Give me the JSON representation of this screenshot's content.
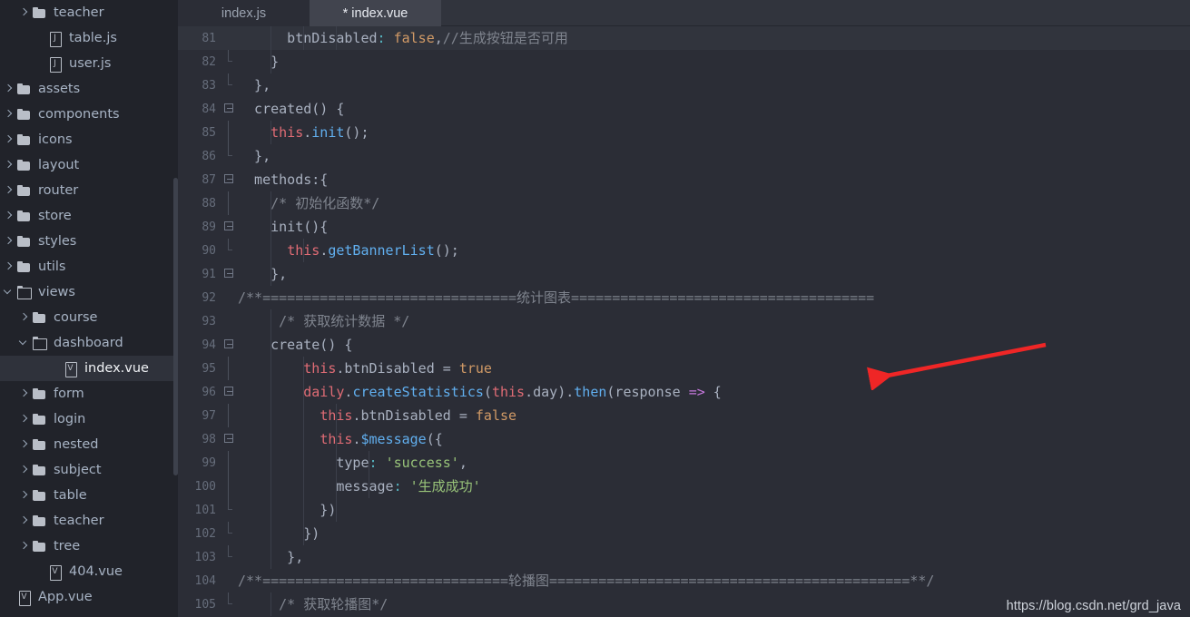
{
  "sidebar": {
    "scrollbar": true,
    "items": [
      {
        "label": "teacher",
        "indent": 2,
        "arrow": "right",
        "icon": "folder-icon",
        "selected": false
      },
      {
        "label": "table.js",
        "indent": 3,
        "arrow": "none",
        "icon": "js-file-icon",
        "selected": false
      },
      {
        "label": "user.js",
        "indent": 3,
        "arrow": "none",
        "icon": "js-file-icon",
        "selected": false
      },
      {
        "label": "assets",
        "indent": 1,
        "arrow": "right",
        "icon": "folder-icon",
        "selected": false
      },
      {
        "label": "components",
        "indent": 1,
        "arrow": "right",
        "icon": "folder-icon",
        "selected": false
      },
      {
        "label": "icons",
        "indent": 1,
        "arrow": "right",
        "icon": "folder-icon",
        "selected": false
      },
      {
        "label": "layout",
        "indent": 1,
        "arrow": "right",
        "icon": "folder-icon",
        "selected": false
      },
      {
        "label": "router",
        "indent": 1,
        "arrow": "right",
        "icon": "folder-icon",
        "selected": false
      },
      {
        "label": "store",
        "indent": 1,
        "arrow": "right",
        "icon": "folder-icon",
        "selected": false
      },
      {
        "label": "styles",
        "indent": 1,
        "arrow": "right",
        "icon": "folder-icon",
        "selected": false
      },
      {
        "label": "utils",
        "indent": 1,
        "arrow": "right",
        "icon": "folder-icon",
        "selected": false
      },
      {
        "label": "views",
        "indent": 1,
        "arrow": "down",
        "icon": "folder-open-icon",
        "selected": false
      },
      {
        "label": "course",
        "indent": 2,
        "arrow": "right",
        "icon": "folder-icon",
        "selected": false
      },
      {
        "label": "dashboard",
        "indent": 2,
        "arrow": "down",
        "icon": "folder-open-icon",
        "selected": false
      },
      {
        "label": "index.vue",
        "indent": 4,
        "arrow": "none",
        "icon": "vue-file-icon",
        "selected": true
      },
      {
        "label": "form",
        "indent": 2,
        "arrow": "right",
        "icon": "folder-icon",
        "selected": false
      },
      {
        "label": "login",
        "indent": 2,
        "arrow": "right",
        "icon": "folder-icon",
        "selected": false
      },
      {
        "label": "nested",
        "indent": 2,
        "arrow": "right",
        "icon": "folder-icon",
        "selected": false
      },
      {
        "label": "subject",
        "indent": 2,
        "arrow": "right",
        "icon": "folder-icon",
        "selected": false
      },
      {
        "label": "table",
        "indent": 2,
        "arrow": "right",
        "icon": "folder-icon",
        "selected": false
      },
      {
        "label": "teacher",
        "indent": 2,
        "arrow": "right",
        "icon": "folder-icon",
        "selected": false
      },
      {
        "label": "tree",
        "indent": 2,
        "arrow": "right",
        "icon": "folder-icon",
        "selected": false
      },
      {
        "label": "404.vue",
        "indent": 3,
        "arrow": "none",
        "icon": "vue-file-icon",
        "selected": false
      },
      {
        "label": "App.vue",
        "indent": 1,
        "arrow": "none",
        "icon": "vue-file-icon",
        "selected": false
      }
    ]
  },
  "tabs": [
    {
      "label": "index.js",
      "active": false,
      "modified": false
    },
    {
      "label": "* index.vue",
      "active": true,
      "modified": true
    }
  ],
  "editor": {
    "watermark": "https://blog.csdn.net/grd_java",
    "lines": [
      {
        "number": "81",
        "current": true,
        "fold": "none",
        "guides": [
          4,
          8,
          12
        ],
        "tokens": [
          {
            "text": "      btnDisabled",
            "cls": "t-plain"
          },
          {
            "text": ":",
            "cls": "t-op"
          },
          {
            "text": " ",
            "cls": "t-plain"
          },
          {
            "text": "false",
            "cls": "t-num"
          },
          {
            "text": ",",
            "cls": "t-plain"
          },
          {
            "text": "//生成按钮是否可用",
            "cls": "t-cmt"
          }
        ]
      },
      {
        "number": "82",
        "current": false,
        "fold": "end",
        "guides": [
          4
        ],
        "tokens": [
          {
            "text": "    }",
            "cls": "t-plain"
          }
        ]
      },
      {
        "number": "83",
        "current": false,
        "fold": "end",
        "guides": [],
        "tokens": [
          {
            "text": "  },",
            "cls": "t-plain"
          }
        ]
      },
      {
        "number": "84",
        "current": false,
        "fold": "box",
        "guides": [],
        "tokens": [
          {
            "text": "  created",
            "cls": "t-plain"
          },
          {
            "text": "() {",
            "cls": "t-plain"
          }
        ]
      },
      {
        "number": "85",
        "current": false,
        "fold": "line",
        "guides": [
          4
        ],
        "tokens": [
          {
            "text": "    ",
            "cls": "t-plain"
          },
          {
            "text": "this",
            "cls": "t-this"
          },
          {
            "text": ".",
            "cls": "t-plain"
          },
          {
            "text": "init",
            "cls": "t-fn"
          },
          {
            "text": "();",
            "cls": "t-plain"
          }
        ]
      },
      {
        "number": "86",
        "current": false,
        "fold": "end",
        "guides": [],
        "tokens": [
          {
            "text": "  },",
            "cls": "t-plain"
          }
        ]
      },
      {
        "number": "87",
        "current": false,
        "fold": "box",
        "guides": [],
        "tokens": [
          {
            "text": "  methods:{",
            "cls": "t-plain"
          }
        ]
      },
      {
        "number": "88",
        "current": false,
        "fold": "line",
        "guides": [
          4
        ],
        "tokens": [
          {
            "text": "    /* 初始化函数*/",
            "cls": "t-cmt"
          }
        ]
      },
      {
        "number": "89",
        "current": false,
        "fold": "box",
        "guides": [
          4
        ],
        "tokens": [
          {
            "text": "    init(){",
            "cls": "t-plain"
          }
        ]
      },
      {
        "number": "90",
        "current": false,
        "fold": "end",
        "guides": [
          4,
          8
        ],
        "tokens": [
          {
            "text": "      ",
            "cls": "t-plain"
          },
          {
            "text": "this",
            "cls": "t-this"
          },
          {
            "text": ".",
            "cls": "t-plain"
          },
          {
            "text": "getBannerList",
            "cls": "t-fn"
          },
          {
            "text": "();",
            "cls": "t-plain"
          }
        ]
      },
      {
        "number": "91",
        "current": false,
        "fold": "box",
        "guides": [
          4
        ],
        "tokens": [
          {
            "text": "    },",
            "cls": "t-plain"
          }
        ]
      },
      {
        "number": "92",
        "current": false,
        "fold": "none",
        "guides": [],
        "tokens": [
          {
            "text": "/**===============================统计图表=====================================",
            "cls": "t-cmt"
          }
        ]
      },
      {
        "number": "93",
        "current": false,
        "fold": "none",
        "guides": [
          4
        ],
        "tokens": [
          {
            "text": "     /* 获取统计数据 */",
            "cls": "t-cmt"
          }
        ]
      },
      {
        "number": "94",
        "current": false,
        "fold": "box",
        "guides": [
          4
        ],
        "tokens": [
          {
            "text": "    create() {",
            "cls": "t-plain"
          }
        ]
      },
      {
        "number": "95",
        "current": false,
        "fold": "line",
        "guides": [
          4,
          8
        ],
        "tokens": [
          {
            "text": "        ",
            "cls": "t-plain"
          },
          {
            "text": "this",
            "cls": "t-this"
          },
          {
            "text": ".btnDisabled ",
            "cls": "t-plain"
          },
          {
            "text": "=",
            "cls": "t-plain"
          },
          {
            "text": " ",
            "cls": "t-plain"
          },
          {
            "text": "true",
            "cls": "t-num"
          }
        ]
      },
      {
        "number": "96",
        "current": false,
        "fold": "box",
        "guides": [
          4,
          8
        ],
        "tokens": [
          {
            "text": "        ",
            "cls": "t-plain"
          },
          {
            "text": "daily",
            "cls": "t-this"
          },
          {
            "text": ".",
            "cls": "t-plain"
          },
          {
            "text": "createStatistics",
            "cls": "t-fn"
          },
          {
            "text": "(",
            "cls": "t-plain"
          },
          {
            "text": "this",
            "cls": "t-this"
          },
          {
            "text": ".day).",
            "cls": "t-plain"
          },
          {
            "text": "then",
            "cls": "t-fn"
          },
          {
            "text": "(response ",
            "cls": "t-plain"
          },
          {
            "text": "=>",
            "cls": "t-arrow"
          },
          {
            "text": " {",
            "cls": "t-plain"
          }
        ]
      },
      {
        "number": "97",
        "current": false,
        "fold": "line",
        "guides": [
          4,
          8,
          12
        ],
        "tokens": [
          {
            "text": "          ",
            "cls": "t-plain"
          },
          {
            "text": "this",
            "cls": "t-this"
          },
          {
            "text": ".btnDisabled ",
            "cls": "t-plain"
          },
          {
            "text": "=",
            "cls": "t-plain"
          },
          {
            "text": " ",
            "cls": "t-plain"
          },
          {
            "text": "false",
            "cls": "t-num"
          }
        ]
      },
      {
        "number": "98",
        "current": false,
        "fold": "box",
        "guides": [
          4,
          8,
          12
        ],
        "tokens": [
          {
            "text": "          ",
            "cls": "t-plain"
          },
          {
            "text": "this",
            "cls": "t-this"
          },
          {
            "text": ".",
            "cls": "t-plain"
          },
          {
            "text": "$message",
            "cls": "t-fn"
          },
          {
            "text": "({",
            "cls": "t-plain"
          }
        ]
      },
      {
        "number": "99",
        "current": false,
        "fold": "line",
        "guides": [
          4,
          8,
          12,
          16
        ],
        "tokens": [
          {
            "text": "            type",
            "cls": "t-plain"
          },
          {
            "text": ":",
            "cls": "t-op"
          },
          {
            "text": " ",
            "cls": "t-plain"
          },
          {
            "text": "'success'",
            "cls": "t-str"
          },
          {
            "text": ",",
            "cls": "t-plain"
          }
        ]
      },
      {
        "number": "100",
        "current": false,
        "fold": "line",
        "guides": [
          4,
          8,
          12,
          16
        ],
        "tokens": [
          {
            "text": "            message",
            "cls": "t-plain"
          },
          {
            "text": ":",
            "cls": "t-op"
          },
          {
            "text": " ",
            "cls": "t-plain"
          },
          {
            "text": "'生成成功'",
            "cls": "t-str"
          }
        ]
      },
      {
        "number": "101",
        "current": false,
        "fold": "end",
        "guides": [
          4,
          8,
          12
        ],
        "tokens": [
          {
            "text": "          })",
            "cls": "t-plain"
          }
        ]
      },
      {
        "number": "102",
        "current": false,
        "fold": "end",
        "guides": [
          4,
          8
        ],
        "tokens": [
          {
            "text": "        })",
            "cls": "t-plain"
          }
        ]
      },
      {
        "number": "103",
        "current": false,
        "fold": "end",
        "guides": [
          4
        ],
        "tokens": [
          {
            "text": "      },",
            "cls": "t-plain"
          }
        ]
      },
      {
        "number": "104",
        "current": false,
        "fold": "none",
        "guides": [],
        "tokens": [
          {
            "text": "/**==============================轮播图============================================**/",
            "cls": "t-cmt"
          }
        ]
      },
      {
        "number": "105",
        "current": false,
        "fold": "end",
        "guides": [
          4
        ],
        "tokens": [
          {
            "text": "     /* 获取轮播图*/",
            "cls": "t-cmt"
          }
        ]
      }
    ]
  },
  "annotation": {
    "arrow_color": "#ef2626",
    "name": "red-pointer-arrow"
  },
  "colors": {
    "sidebar_bg": "#21232a",
    "editor_bg": "#2b2d36",
    "tab_active_bg": "#41444e",
    "tabbar_bg": "#31343d",
    "selection_bg": "#2f323b",
    "accent_red": "#ef2626"
  }
}
